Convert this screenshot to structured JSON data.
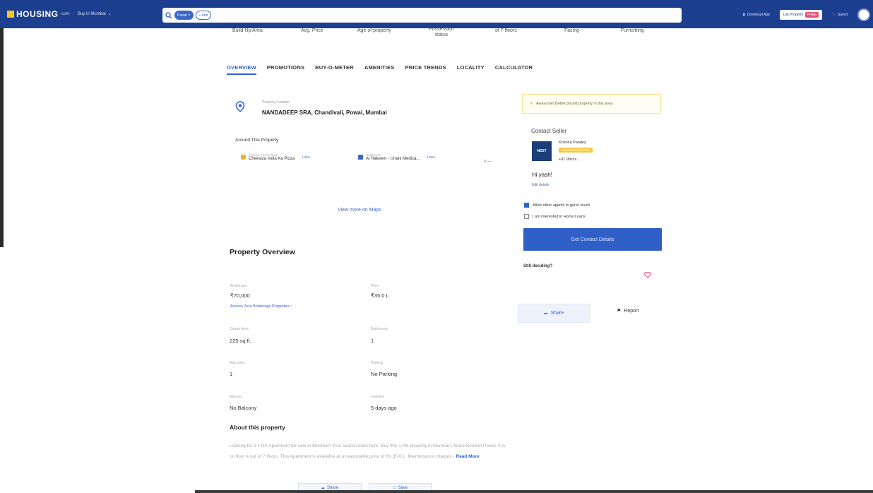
{
  "header": {
    "logo_text": "HOUSING",
    "logo_sub": ".com",
    "city": "Buy in Mumbai",
    "search_chip": "Powai",
    "search_add": "+ Add",
    "download_app": "Download App",
    "list_property": "List Property",
    "free_badge": "FREE",
    "saved": "Saved",
    "colors": {
      "bar": "#1d3f8f",
      "accent": "#2e63d6",
      "logo": "#f3c623"
    }
  },
  "stats": {
    "built_up": "Build Up Area",
    "avg_price": "Avg. Price",
    "age": "Age of property",
    "possession_l1": "Possession",
    "possession_l2": "status",
    "floors": "of 7 floors",
    "facing": "Facing",
    "furnishing": "Furnishing"
  },
  "tabs": [
    "OVERVIEW",
    "PROMOTIONS",
    "BUY-O-METER",
    "AMENITIES",
    "PRICE TRENDS",
    "LOCALITY",
    "CALCULATOR"
  ],
  "location": {
    "label": "Property Location",
    "address": "NANDADEEP SRA, Chandivali, Powai, Mumbai",
    "around_title": "Around This Property",
    "pois": [
      {
        "category": "Popular Food Outlet",
        "name": "Cheesiza India Ka Pizza",
        "distance": "1.2km",
        "icon": "food-icon"
      },
      {
        "category": "Healthcare",
        "name": "Al Hakeem - Unani Medica...",
        "distance": "1.5km",
        "icon": "medical-icon"
      }
    ],
    "more": "≡ —",
    "maps_link": "View more on Maps"
  },
  "overview": {
    "title": "Property Overview",
    "items": [
      {
        "label": "Brokerage",
        "value": "₹70,000"
      },
      {
        "label": "Price",
        "value": "₹35.0 L"
      },
      {
        "label": "Carpet Area",
        "value": "225 sq.ft."
      },
      {
        "label": "Bathrooms",
        "value": "1"
      },
      {
        "label": "Balconies",
        "value": "1"
      },
      {
        "label": "Parking",
        "value": "No Parking"
      },
      {
        "label": "Balcony",
        "value": "No Balcony"
      },
      {
        "label": "Updated",
        "value": "5 days ago"
      }
    ],
    "brokerage_link": "Access Zero Brokerage Properties ›"
  },
  "contact": {
    "highlight": "Awesome! Better priced property in this area",
    "title": "Contact Seller",
    "agent_logo": "NEST",
    "agent_name": "Krishna Pandey",
    "agent_badge": "HOUSING EXPERT",
    "agent_phone": "+91 98xxx...",
    "greeting": "Hi yash!",
    "edit": "Edit details",
    "allow_agents": "Allow other agents to get in touch",
    "home_loans": "I am interested in Home Loans",
    "allow_checked": true,
    "cta": "Get Contact Details",
    "still_deciding": "Still deciding?",
    "share": "Share",
    "report": "Report"
  },
  "about": {
    "title": "About this property",
    "text": "Looking for a 1 RK Apartment for sale in Mumbai? Your search ends here. Buy this 1 RK property in Mumbai's finest location Powai. It is on floor 4 out of 7 floors. This Apartment is available at a reasonable price of Rs 35.0 L. Maintenance charges -",
    "read_more": "Read More",
    "share": "Share",
    "save": "Save"
  }
}
